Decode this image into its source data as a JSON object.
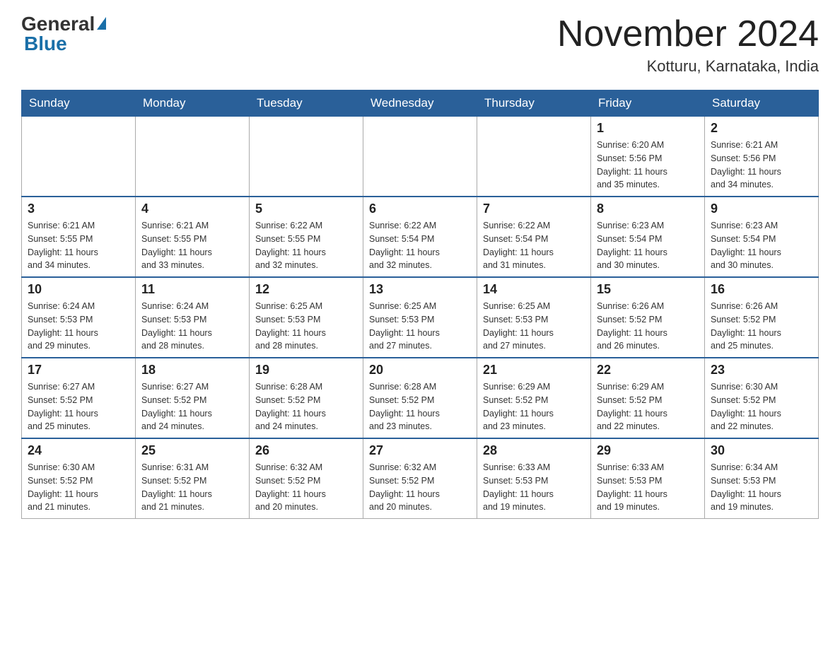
{
  "header": {
    "logo_general": "General",
    "logo_blue": "Blue",
    "month_title": "November 2024",
    "location": "Kotturu, Karnataka, India"
  },
  "days_of_week": [
    "Sunday",
    "Monday",
    "Tuesday",
    "Wednesday",
    "Thursday",
    "Friday",
    "Saturday"
  ],
  "weeks": [
    [
      {
        "day": "",
        "info": ""
      },
      {
        "day": "",
        "info": ""
      },
      {
        "day": "",
        "info": ""
      },
      {
        "day": "",
        "info": ""
      },
      {
        "day": "",
        "info": ""
      },
      {
        "day": "1",
        "info": "Sunrise: 6:20 AM\nSunset: 5:56 PM\nDaylight: 11 hours\nand 35 minutes."
      },
      {
        "day": "2",
        "info": "Sunrise: 6:21 AM\nSunset: 5:56 PM\nDaylight: 11 hours\nand 34 minutes."
      }
    ],
    [
      {
        "day": "3",
        "info": "Sunrise: 6:21 AM\nSunset: 5:55 PM\nDaylight: 11 hours\nand 34 minutes."
      },
      {
        "day": "4",
        "info": "Sunrise: 6:21 AM\nSunset: 5:55 PM\nDaylight: 11 hours\nand 33 minutes."
      },
      {
        "day": "5",
        "info": "Sunrise: 6:22 AM\nSunset: 5:55 PM\nDaylight: 11 hours\nand 32 minutes."
      },
      {
        "day": "6",
        "info": "Sunrise: 6:22 AM\nSunset: 5:54 PM\nDaylight: 11 hours\nand 32 minutes."
      },
      {
        "day": "7",
        "info": "Sunrise: 6:22 AM\nSunset: 5:54 PM\nDaylight: 11 hours\nand 31 minutes."
      },
      {
        "day": "8",
        "info": "Sunrise: 6:23 AM\nSunset: 5:54 PM\nDaylight: 11 hours\nand 30 minutes."
      },
      {
        "day": "9",
        "info": "Sunrise: 6:23 AM\nSunset: 5:54 PM\nDaylight: 11 hours\nand 30 minutes."
      }
    ],
    [
      {
        "day": "10",
        "info": "Sunrise: 6:24 AM\nSunset: 5:53 PM\nDaylight: 11 hours\nand 29 minutes."
      },
      {
        "day": "11",
        "info": "Sunrise: 6:24 AM\nSunset: 5:53 PM\nDaylight: 11 hours\nand 28 minutes."
      },
      {
        "day": "12",
        "info": "Sunrise: 6:25 AM\nSunset: 5:53 PM\nDaylight: 11 hours\nand 28 minutes."
      },
      {
        "day": "13",
        "info": "Sunrise: 6:25 AM\nSunset: 5:53 PM\nDaylight: 11 hours\nand 27 minutes."
      },
      {
        "day": "14",
        "info": "Sunrise: 6:25 AM\nSunset: 5:53 PM\nDaylight: 11 hours\nand 27 minutes."
      },
      {
        "day": "15",
        "info": "Sunrise: 6:26 AM\nSunset: 5:52 PM\nDaylight: 11 hours\nand 26 minutes."
      },
      {
        "day": "16",
        "info": "Sunrise: 6:26 AM\nSunset: 5:52 PM\nDaylight: 11 hours\nand 25 minutes."
      }
    ],
    [
      {
        "day": "17",
        "info": "Sunrise: 6:27 AM\nSunset: 5:52 PM\nDaylight: 11 hours\nand 25 minutes."
      },
      {
        "day": "18",
        "info": "Sunrise: 6:27 AM\nSunset: 5:52 PM\nDaylight: 11 hours\nand 24 minutes."
      },
      {
        "day": "19",
        "info": "Sunrise: 6:28 AM\nSunset: 5:52 PM\nDaylight: 11 hours\nand 24 minutes."
      },
      {
        "day": "20",
        "info": "Sunrise: 6:28 AM\nSunset: 5:52 PM\nDaylight: 11 hours\nand 23 minutes."
      },
      {
        "day": "21",
        "info": "Sunrise: 6:29 AM\nSunset: 5:52 PM\nDaylight: 11 hours\nand 23 minutes."
      },
      {
        "day": "22",
        "info": "Sunrise: 6:29 AM\nSunset: 5:52 PM\nDaylight: 11 hours\nand 22 minutes."
      },
      {
        "day": "23",
        "info": "Sunrise: 6:30 AM\nSunset: 5:52 PM\nDaylight: 11 hours\nand 22 minutes."
      }
    ],
    [
      {
        "day": "24",
        "info": "Sunrise: 6:30 AM\nSunset: 5:52 PM\nDaylight: 11 hours\nand 21 minutes."
      },
      {
        "day": "25",
        "info": "Sunrise: 6:31 AM\nSunset: 5:52 PM\nDaylight: 11 hours\nand 21 minutes."
      },
      {
        "day": "26",
        "info": "Sunrise: 6:32 AM\nSunset: 5:52 PM\nDaylight: 11 hours\nand 20 minutes."
      },
      {
        "day": "27",
        "info": "Sunrise: 6:32 AM\nSunset: 5:52 PM\nDaylight: 11 hours\nand 20 minutes."
      },
      {
        "day": "28",
        "info": "Sunrise: 6:33 AM\nSunset: 5:53 PM\nDaylight: 11 hours\nand 19 minutes."
      },
      {
        "day": "29",
        "info": "Sunrise: 6:33 AM\nSunset: 5:53 PM\nDaylight: 11 hours\nand 19 minutes."
      },
      {
        "day": "30",
        "info": "Sunrise: 6:34 AM\nSunset: 5:53 PM\nDaylight: 11 hours\nand 19 minutes."
      }
    ]
  ]
}
